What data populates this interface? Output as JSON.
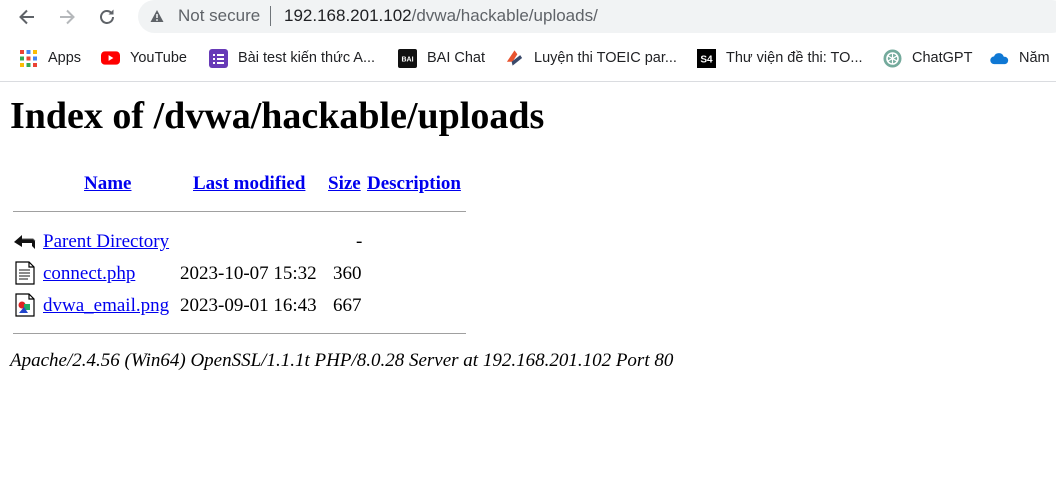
{
  "browser": {
    "security_label": "Not secure",
    "url_host": "192.168.201.102",
    "url_path": "/dvwa/hackable/uploads/"
  },
  "bookmarks": [
    {
      "label": "Apps",
      "icon": "apps-grid-icon"
    },
    {
      "label": "YouTube",
      "icon": "youtube-icon"
    },
    {
      "label": "Bài test kiến thức A...",
      "icon": "forms-icon"
    },
    {
      "label": "BAI Chat",
      "icon": "bai-icon"
    },
    {
      "label": "Luyện thi TOEIC par...",
      "icon": "toeic-icon"
    },
    {
      "label": "Thư viện đề thi: TO...",
      "icon": "s4-icon"
    },
    {
      "label": "ChatGPT",
      "icon": "chatgpt-icon"
    },
    {
      "label": "Năm",
      "icon": "cloud-icon"
    }
  ],
  "page": {
    "title": "Index of /dvwa/hackable/uploads",
    "columns": {
      "name": "Name",
      "last_modified": "Last modified",
      "size": "Size",
      "description": "Description"
    },
    "rows": [
      {
        "name": "Parent Directory",
        "modified": "",
        "size": "-",
        "icon": "back-arrow-icon"
      },
      {
        "name": "connect.php",
        "modified": "2023-10-07 15:32",
        "size": "360",
        "icon": "text-file-icon"
      },
      {
        "name": "dvwa_email.png",
        "modified": "2023-09-01 16:43",
        "size": "667",
        "icon": "image-file-icon"
      }
    ],
    "footer": "Apache/2.4.56 (Win64) OpenSSL/1.1.1t PHP/8.0.28 Server at 192.168.201.102 Port 80"
  }
}
